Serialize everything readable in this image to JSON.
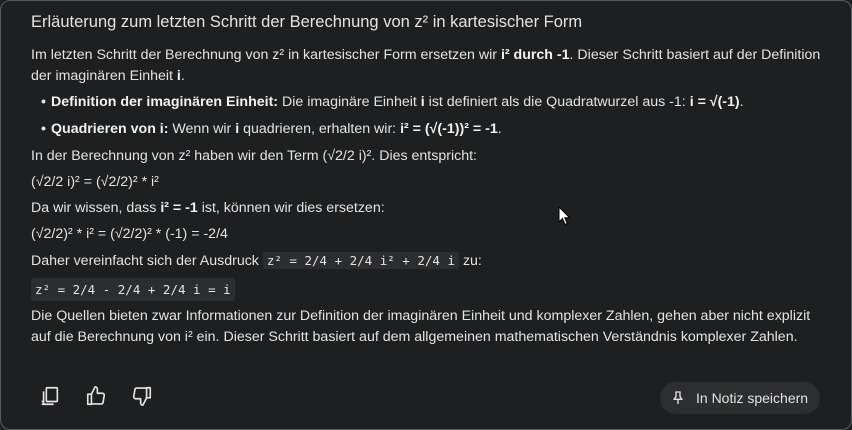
{
  "title": "Erläuterung zum letzten Schritt der Berechnung von z² in kartesischer Form",
  "para1": {
    "t1": "Im letzten Schritt der Berechnung von z² in kartesischer Form ersetzen wir ",
    "b1": "i² durch -1",
    "t2": ". Dieser Schritt basiert auf der Definition der imaginären Einheit ",
    "b2": "i",
    "t3": "."
  },
  "bullet1": {
    "label": "Definition der imaginären Einheit:",
    "t1": " Die imaginäre Einheit ",
    "b1": "i",
    "t2": " ist definiert als die Quadratwurzel aus -1: ",
    "b2": "i = √(-1)",
    "t3": "."
  },
  "bullet2": {
    "label": "Quadrieren von i:",
    "t1": " Wenn wir ",
    "b1": "i",
    "t2": " quadrieren, erhalten wir: ",
    "b2": "i² = (√(-1))² = -1",
    "t3": "."
  },
  "line3": "In der Berechnung von z² haben wir den Term (√2/2 i)². Dies entspricht:",
  "line4": "(√2/2 i)² = (√2/2)² * i²",
  "line5": {
    "t1": "Da wir wissen, dass ",
    "b1": "i² = -1",
    "t2": " ist, können wir dies ersetzen:"
  },
  "line6": "(√2/2)² * i² = (√2/2)² * (-1) = -2/4",
  "line7": {
    "t1": "Daher vereinfacht sich der Ausdruck ",
    "code": "z² = 2/4 + 2/4 i² + 2/4 i",
    "t2": " zu:"
  },
  "codeblock": "z² = 2/4 - 2/4 + 2/4 i = i",
  "closing": "Die Quellen bieten zwar Informationen zur Definition der imaginären Einheit und komplexer Zahlen, gehen aber nicht explizit auf die Berechnung von i² ein. Dieser Schritt basiert auf dem allgemeinen mathematischen Verständnis komplexer Zahlen.",
  "actions": {
    "copy_icon": "copy-icon",
    "like_icon": "thumbs-up-icon",
    "dislike_icon": "thumbs-down-icon",
    "note_label": "In Notiz speichern"
  },
  "colors": {
    "background": "#1e1f20",
    "text": "#e3e3e3",
    "border": "#5a5b5d",
    "button_bg": "#2d2e30",
    "code_bg": "#2c2d2f"
  }
}
